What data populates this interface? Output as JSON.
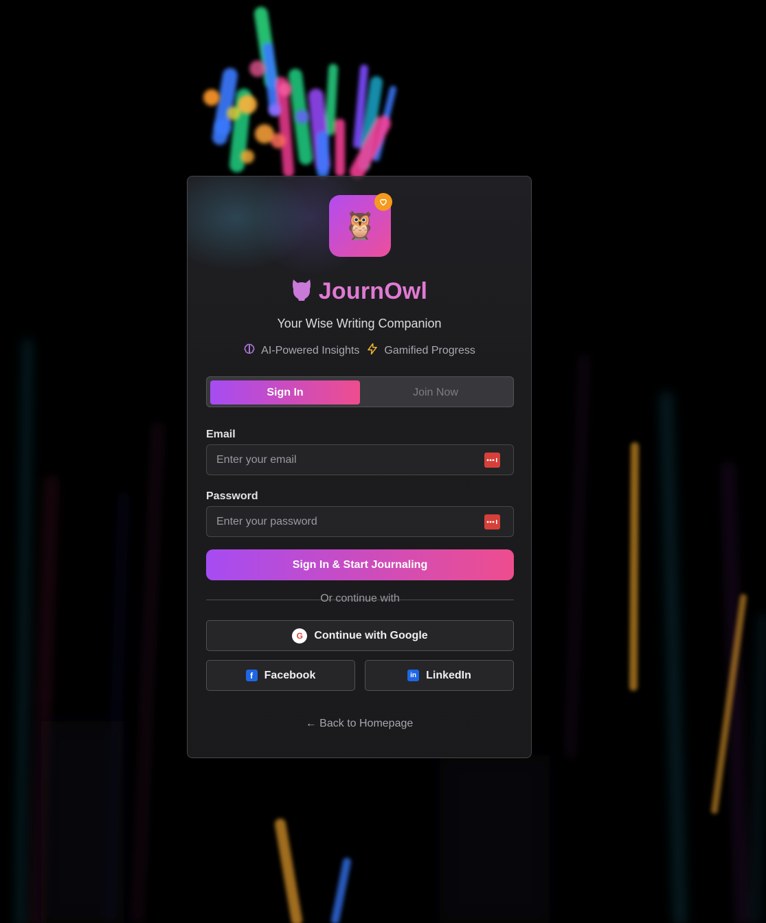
{
  "brand": {
    "name": "JournOwl",
    "tagline": "Your Wise Writing Companion",
    "logo_emoji": "🦉",
    "logo_icon": "owl-icon",
    "badge_icon": "heart-icon"
  },
  "features": [
    {
      "icon": "brain-icon",
      "label": "AI-Powered Insights"
    },
    {
      "icon": "lightning-icon",
      "label": "Gamified Progress"
    }
  ],
  "tabs": [
    {
      "label": "Sign In",
      "active": true
    },
    {
      "label": "Join Now",
      "active": false
    }
  ],
  "form": {
    "email_label": "Email",
    "email_placeholder": "Enter your email",
    "email_value": "",
    "password_label": "Password",
    "password_placeholder": "Enter your password",
    "password_value": "",
    "field_icon": "password-manager-icon",
    "submit_label": "Sign In & Start Journaling"
  },
  "divider_text": "Or continue with",
  "social": {
    "google_label": "Continue with Google",
    "google_icon_letter": "G",
    "facebook_label": "Facebook",
    "facebook_icon_letter": "f",
    "linkedin_label": "LinkedIn",
    "linkedin_icon_letter": "in"
  },
  "back_link": "← Back to Homepage",
  "colors": {
    "accent_start": "#a64cf2",
    "accent_end": "#ee4d8e",
    "brand_text": "#e07ad2",
    "badge": "#f59a1c",
    "background": "#000000"
  }
}
